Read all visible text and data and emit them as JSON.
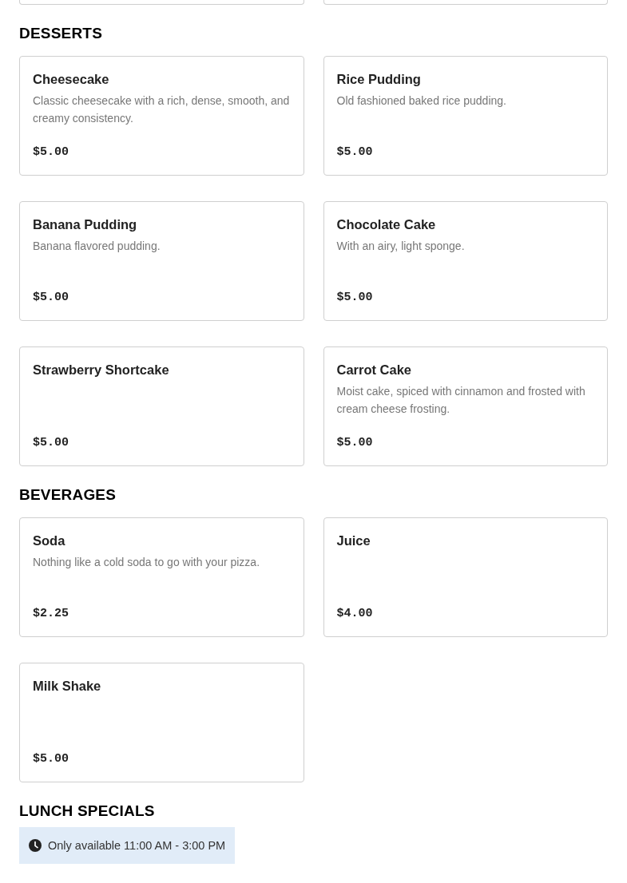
{
  "sections": [
    {
      "items": [
        {
          "kind": "cut_off"
        },
        {
          "kind": "cut_off"
        }
      ]
    },
    {
      "heading": "DESSERTS",
      "items": [
        {
          "kind": "full",
          "name": "Cheesecake",
          "description": "Classic cheesecake with a rich, dense, smooth, and creamy consistency.",
          "price": "$5.00"
        },
        {
          "kind": "full",
          "name": "Rice Pudding",
          "description": "Old fashioned baked rice pudding.",
          "price": "$5.00"
        },
        {
          "kind": "full",
          "name": "Banana Pudding",
          "description": "Banana flavored pudding.",
          "price": "$5.00"
        },
        {
          "kind": "full",
          "name": "Chocolate Cake",
          "description": "With an airy, light sponge.",
          "price": "$5.00"
        },
        {
          "kind": "full",
          "name": "Strawberry Shortcake",
          "price": "$5.00"
        },
        {
          "kind": "full",
          "name": "Carrot Cake",
          "description": "Moist cake, spiced with cinnamon and frosted with cream cheese frosting.",
          "price": "$5.00"
        }
      ]
    },
    {
      "heading": "BEVERAGES",
      "items": [
        {
          "kind": "full",
          "name": "Soda",
          "description": "Nothing like a cold soda to go with your pizza.",
          "price": "$2.25"
        },
        {
          "kind": "full",
          "name": "Juice",
          "price": "$4.00"
        },
        {
          "kind": "full",
          "name": "Milk Shake",
          "price": "$5.00"
        }
      ]
    },
    {
      "heading": "LUNCH SPECIALS",
      "notice": "Only available 11:00 AM - 3:00 PM"
    }
  ]
}
